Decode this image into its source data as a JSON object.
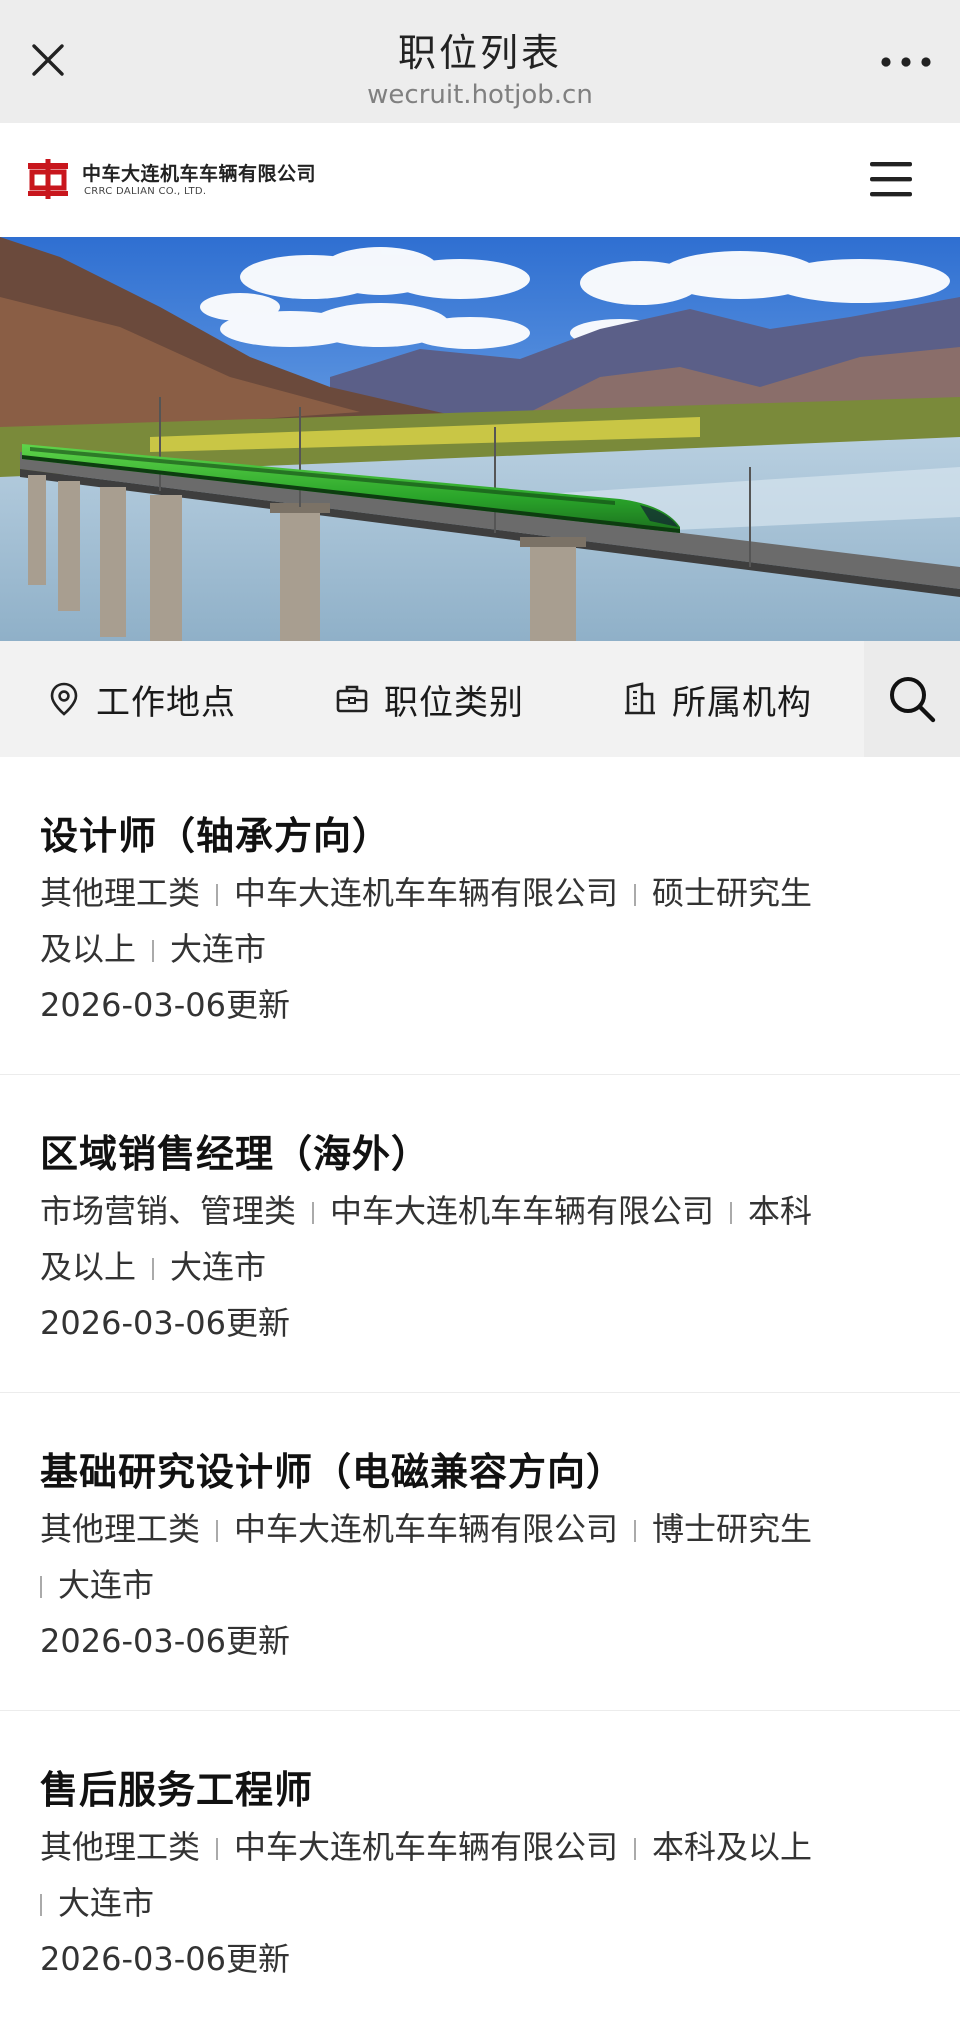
{
  "topbar": {
    "title": "职位列表",
    "domain": "wecruit.hotjob.cn"
  },
  "company": {
    "name_cn": "中车大连机车车辆有限公司",
    "name_en": "CRRC DALIAN CO., LTD.",
    "brand_color": "#c8161d"
  },
  "filters": [
    {
      "label": "工作地点",
      "icon": "location-pin-icon"
    },
    {
      "label": "职位类别",
      "icon": "briefcase-icon"
    },
    {
      "label": "所属机构",
      "icon": "building-icon"
    }
  ],
  "search": {
    "icon": "search-icon"
  },
  "jobs": [
    {
      "title": "设计师（轴承方向）",
      "category": "其他理工类",
      "company": "中车大连机车车辆有限公司",
      "education": "硕士研究生及以上",
      "edu_line1": "硕士研究生",
      "edu_line2": "及以上",
      "city": "大连市",
      "updated": "2026-03-06更新"
    },
    {
      "title": "区域销售经理（海外）",
      "category": "市场营销、管理类",
      "company": "中车大连机车车辆有限公司",
      "education": "本科及以上",
      "edu_line1": "本科",
      "edu_line2": "及以上",
      "city": "大连市",
      "updated": "2026-03-06更新"
    },
    {
      "title": "基础研究设计师（电磁兼容方向）",
      "category": "其他理工类",
      "company": "中车大连机车车辆有限公司",
      "education": "博士研究生",
      "city": "大连市",
      "updated": "2026-03-06更新"
    },
    {
      "title": "售后服务工程师",
      "category": "其他理工类",
      "company": "中车大连机车车辆有限公司",
      "education": "本科及以上",
      "city": "大连市",
      "updated": "2026-03-06更新"
    }
  ]
}
